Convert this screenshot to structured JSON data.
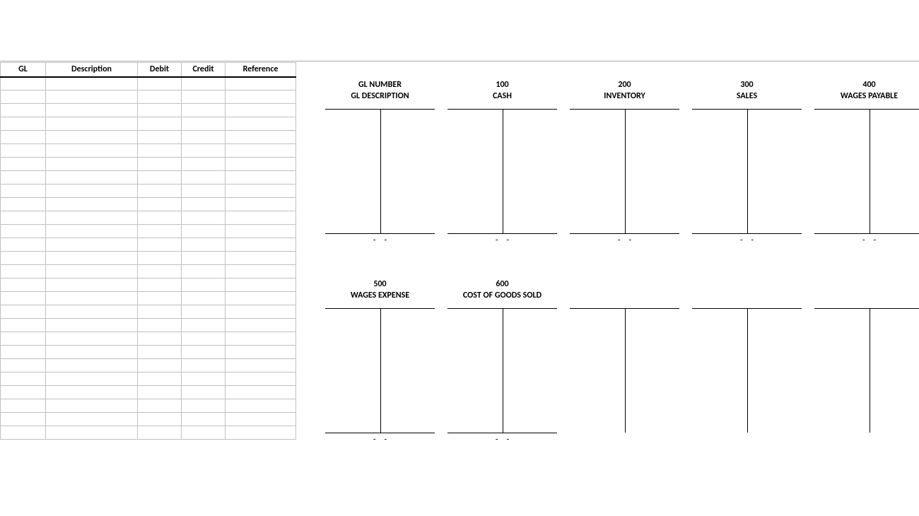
{
  "journal": {
    "columns": [
      "GL",
      "Description",
      "Debit",
      "Credit",
      "Reference"
    ],
    "row_count": 27
  },
  "t_accounts_row1": [
    {
      "number": "GL NUMBER",
      "name": "GL DESCRIPTION",
      "debit_total": "-",
      "credit_total": "-",
      "show_total": true
    },
    {
      "number": "100",
      "name": "CASH",
      "debit_total": "-",
      "credit_total": "-",
      "show_total": true
    },
    {
      "number": "200",
      "name": "INVENTORY",
      "debit_total": "-",
      "credit_total": "-",
      "show_total": true
    },
    {
      "number": "300",
      "name": "SALES",
      "debit_total": "-",
      "credit_total": "-",
      "show_total": true
    },
    {
      "number": "400",
      "name": "WAGES PAYABLE",
      "debit_total": "-",
      "credit_total": "-",
      "show_total": true
    }
  ],
  "t_accounts_row2": [
    {
      "number": "500",
      "name": "WAGES EXPENSE",
      "debit_total": "-",
      "credit_total": "-",
      "show_total": true
    },
    {
      "number": "600",
      "name": "COST OF GOODS SOLD",
      "debit_total": "-",
      "credit_total": "-",
      "show_total": true
    },
    {
      "number": "",
      "name": "",
      "debit_total": "",
      "credit_total": "",
      "show_total": false
    },
    {
      "number": "",
      "name": "",
      "debit_total": "",
      "credit_total": "",
      "show_total": false
    },
    {
      "number": "",
      "name": "",
      "debit_total": "",
      "credit_total": "",
      "show_total": false
    }
  ]
}
